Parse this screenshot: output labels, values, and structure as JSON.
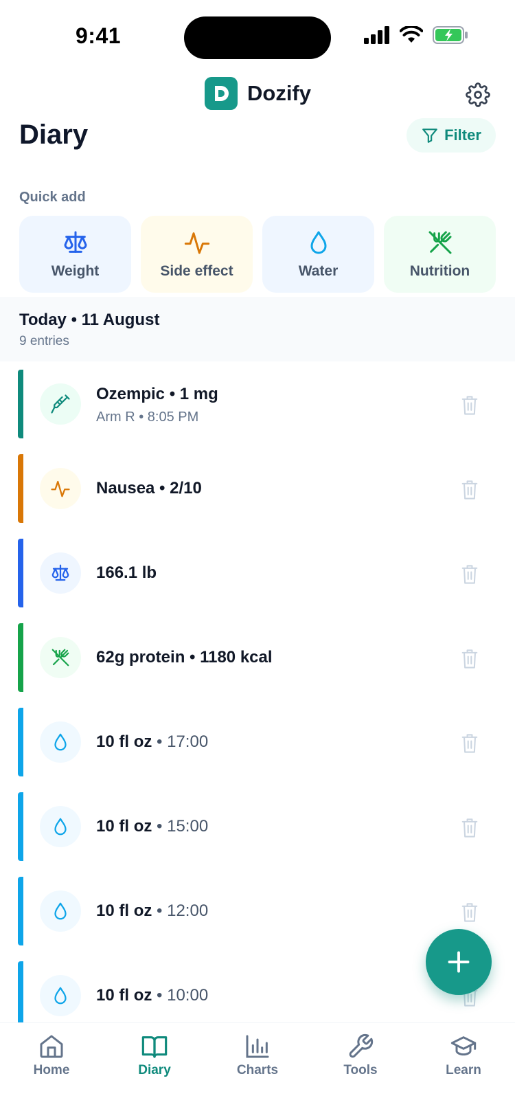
{
  "status_bar": {
    "time": "9:41"
  },
  "header": {
    "app_name": "Dozify",
    "logo_letter": "D"
  },
  "page": {
    "title": "Diary",
    "filter_label": "Filter"
  },
  "quick_add": {
    "label": "Quick add",
    "items": [
      {
        "label": "Weight",
        "icon": "scale-icon",
        "bg": "#eff6ff",
        "color": "#2563eb"
      },
      {
        "label": "Side effect",
        "icon": "pulse-icon",
        "bg": "#fffbeb",
        "color": "#d97706"
      },
      {
        "label": "Water",
        "icon": "drop-icon",
        "bg": "#eff6ff",
        "color": "#0ea5e9"
      },
      {
        "label": "Nutrition",
        "icon": "utensils-icon",
        "bg": "#f0fdf4",
        "color": "#16a34a"
      }
    ]
  },
  "day": {
    "title": "Today • 11 August",
    "count": "9 entries"
  },
  "entries": [
    {
      "text": "Ozempic • 1 mg",
      "sub": "Arm R • 8:05 PM",
      "time": "",
      "icon": "syringe-icon",
      "bar": "#0f8a7c",
      "bg": "#ecfdf5",
      "color": "#0f8a7c"
    },
    {
      "text": "Nausea • 2/10",
      "sub": "",
      "time": "",
      "icon": "pulse-icon",
      "bar": "#d97706",
      "bg": "#fffbeb",
      "color": "#d97706"
    },
    {
      "text": "166.1 lb",
      "sub": "",
      "time": "",
      "icon": "scale-icon",
      "bar": "#2563eb",
      "bg": "#eff6ff",
      "color": "#2563eb"
    },
    {
      "text": "62g protein • 1180 kcal",
      "sub": "",
      "time": "",
      "icon": "utensils-icon",
      "bar": "#16a34a",
      "bg": "#f0fdf4",
      "color": "#16a34a"
    },
    {
      "text": "10 fl oz",
      "sub": "",
      "time": "• 17:00",
      "icon": "drop-icon",
      "bar": "#0ea5e9",
      "bg": "#f0f9ff",
      "color": "#0ea5e9"
    },
    {
      "text": "10 fl oz",
      "sub": "",
      "time": "• 15:00",
      "icon": "drop-icon",
      "bar": "#0ea5e9",
      "bg": "#f0f9ff",
      "color": "#0ea5e9"
    },
    {
      "text": "10 fl oz",
      "sub": "",
      "time": "• 12:00",
      "icon": "drop-icon",
      "bar": "#0ea5e9",
      "bg": "#f0f9ff",
      "color": "#0ea5e9"
    },
    {
      "text": "10 fl oz",
      "sub": "",
      "time": "• 10:00",
      "icon": "drop-icon",
      "bar": "#0ea5e9",
      "bg": "#f0f9ff",
      "color": "#0ea5e9"
    }
  ],
  "tabs": [
    {
      "label": "Home",
      "icon": "home-icon",
      "active": false
    },
    {
      "label": "Diary",
      "icon": "book-icon",
      "active": true
    },
    {
      "label": "Charts",
      "icon": "bar-chart-icon",
      "active": false
    },
    {
      "label": "Tools",
      "icon": "wrench-icon",
      "active": false
    },
    {
      "label": "Learn",
      "icon": "graduation-cap-icon",
      "active": false
    }
  ],
  "colors": {
    "accent": "#17998a",
    "accent_text": "#0f8a7c",
    "tab_inactive": "#64748b"
  }
}
